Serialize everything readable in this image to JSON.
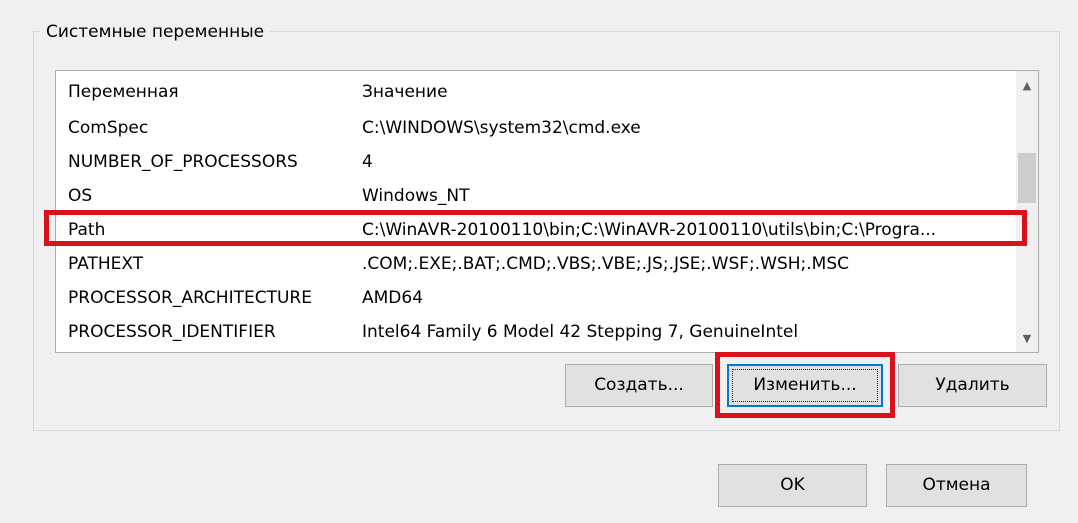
{
  "group": {
    "title": "Системные переменные"
  },
  "list": {
    "columns": [
      "Переменная",
      "Значение"
    ],
    "rows": [
      {
        "name": "ComSpec",
        "value": "C:\\WINDOWS\\system32\\cmd.exe"
      },
      {
        "name": "NUMBER_OF_PROCESSORS",
        "value": "4"
      },
      {
        "name": "OS",
        "value": "Windows_NT"
      },
      {
        "name": "Path",
        "value": "C:\\WinAVR-20100110\\bin;C:\\WinAVR-20100110\\utils\\bin;C:\\Progra..."
      },
      {
        "name": "PATHEXT",
        "value": ".COM;.EXE;.BAT;.CMD;.VBS;.VBE;.JS;.JSE;.WSF;.WSH;.MSC"
      },
      {
        "name": "PROCESSOR_ARCHITECTURE",
        "value": "AMD64"
      },
      {
        "name": "PROCESSOR_IDENTIFIER",
        "value": "Intel64 Family 6 Model 42 Stepping 7, GenuineIntel"
      }
    ],
    "scroll_up_icon": "chevron-up-icon",
    "scroll_down_icon": "chevron-down-icon"
  },
  "buttons": {
    "create": "Создать...",
    "edit": "Изменить...",
    "delete": "Удалить",
    "ok": "OK",
    "cancel": "Отмена"
  },
  "colors": {
    "highlight": "#d9111b",
    "focus_border": "#0078d7",
    "button_face": "#e1e1e1",
    "dialog_background": "#f0f0f0"
  }
}
